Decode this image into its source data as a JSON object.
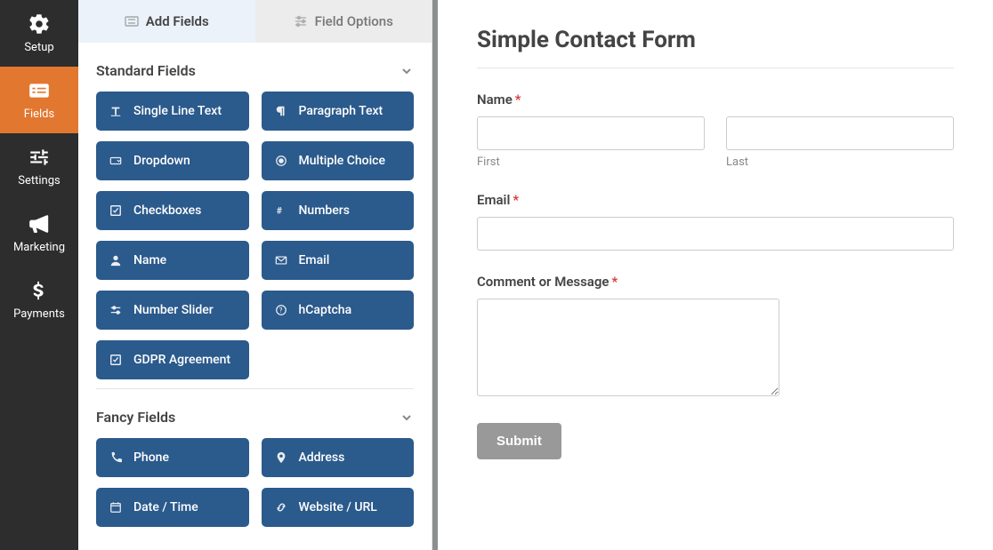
{
  "sidebar": {
    "items": [
      {
        "id": "setup",
        "label": "Setup"
      },
      {
        "id": "fields",
        "label": "Fields"
      },
      {
        "id": "settings",
        "label": "Settings"
      },
      {
        "id": "marketing",
        "label": "Marketing"
      },
      {
        "id": "payments",
        "label": "Payments"
      }
    ]
  },
  "tabs": {
    "add_fields": "Add Fields",
    "field_options": "Field Options"
  },
  "sections": {
    "standard": "Standard Fields",
    "fancy": "Fancy Fields"
  },
  "standard_fields": [
    "Single Line Text",
    "Paragraph Text",
    "Dropdown",
    "Multiple Choice",
    "Checkboxes",
    "Numbers",
    "Name",
    "Email",
    "Number Slider",
    "hCaptcha",
    "GDPR Agreement"
  ],
  "fancy_fields": [
    "Phone",
    "Address",
    "Date / Time",
    "Website / URL"
  ],
  "form": {
    "title": "Simple Contact Form",
    "name_label": "Name",
    "first_sub": "First",
    "last_sub": "Last",
    "email_label": "Email",
    "message_label": "Comment or Message",
    "submit": "Submit"
  },
  "colors": {
    "accent_orange": "#e27730",
    "field_blue": "#2b5a8c",
    "required_red": "#d63638"
  }
}
